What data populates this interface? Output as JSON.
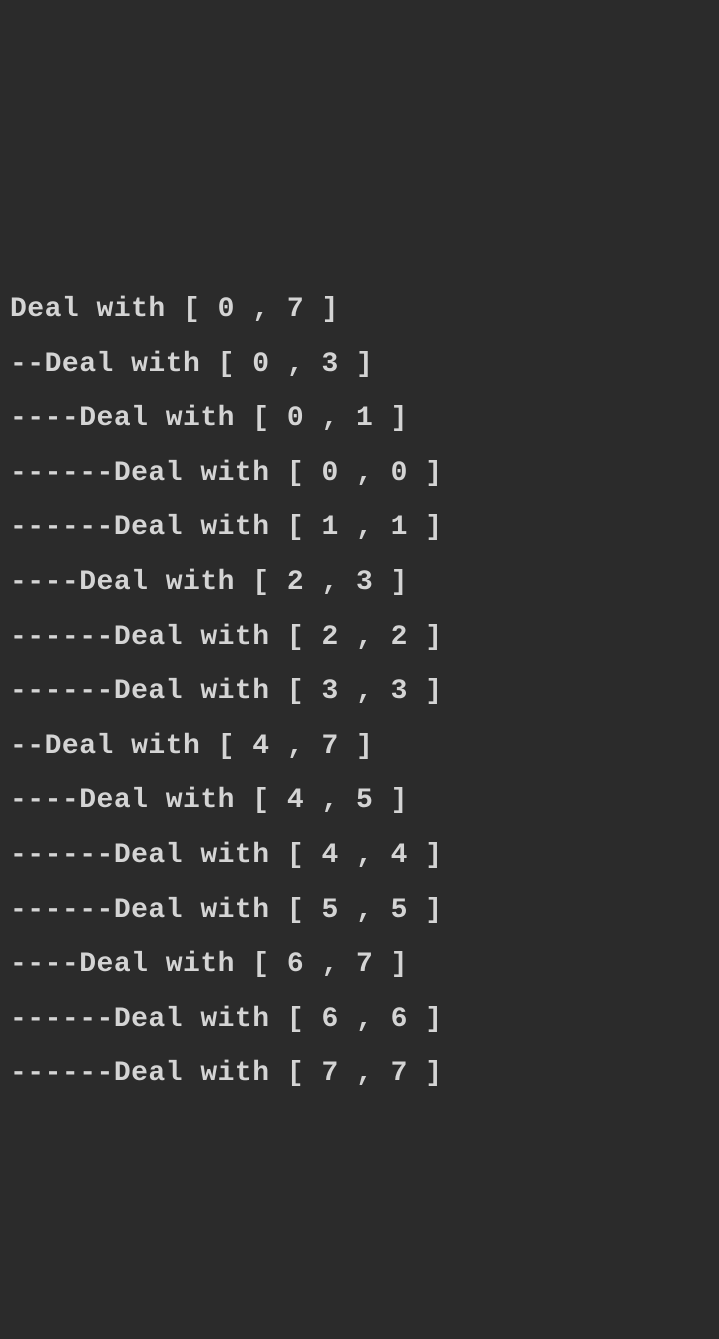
{
  "terminal": {
    "lines": [
      "Deal with [ 0 , 7 ]",
      "--Deal with [ 0 , 3 ]",
      "----Deal with [ 0 , 1 ]",
      "------Deal with [ 0 , 0 ]",
      "------Deal with [ 1 , 1 ]",
      "----Deal with [ 2 , 3 ]",
      "------Deal with [ 2 , 2 ]",
      "------Deal with [ 3 , 3 ]",
      "--Deal with [ 4 , 7 ]",
      "----Deal with [ 4 , 5 ]",
      "------Deal with [ 4 , 4 ]",
      "------Deal with [ 5 , 5 ]",
      "----Deal with [ 6 , 7 ]",
      "------Deal with [ 6 , 6 ]",
      "------Deal with [ 7 , 7 ]"
    ]
  }
}
